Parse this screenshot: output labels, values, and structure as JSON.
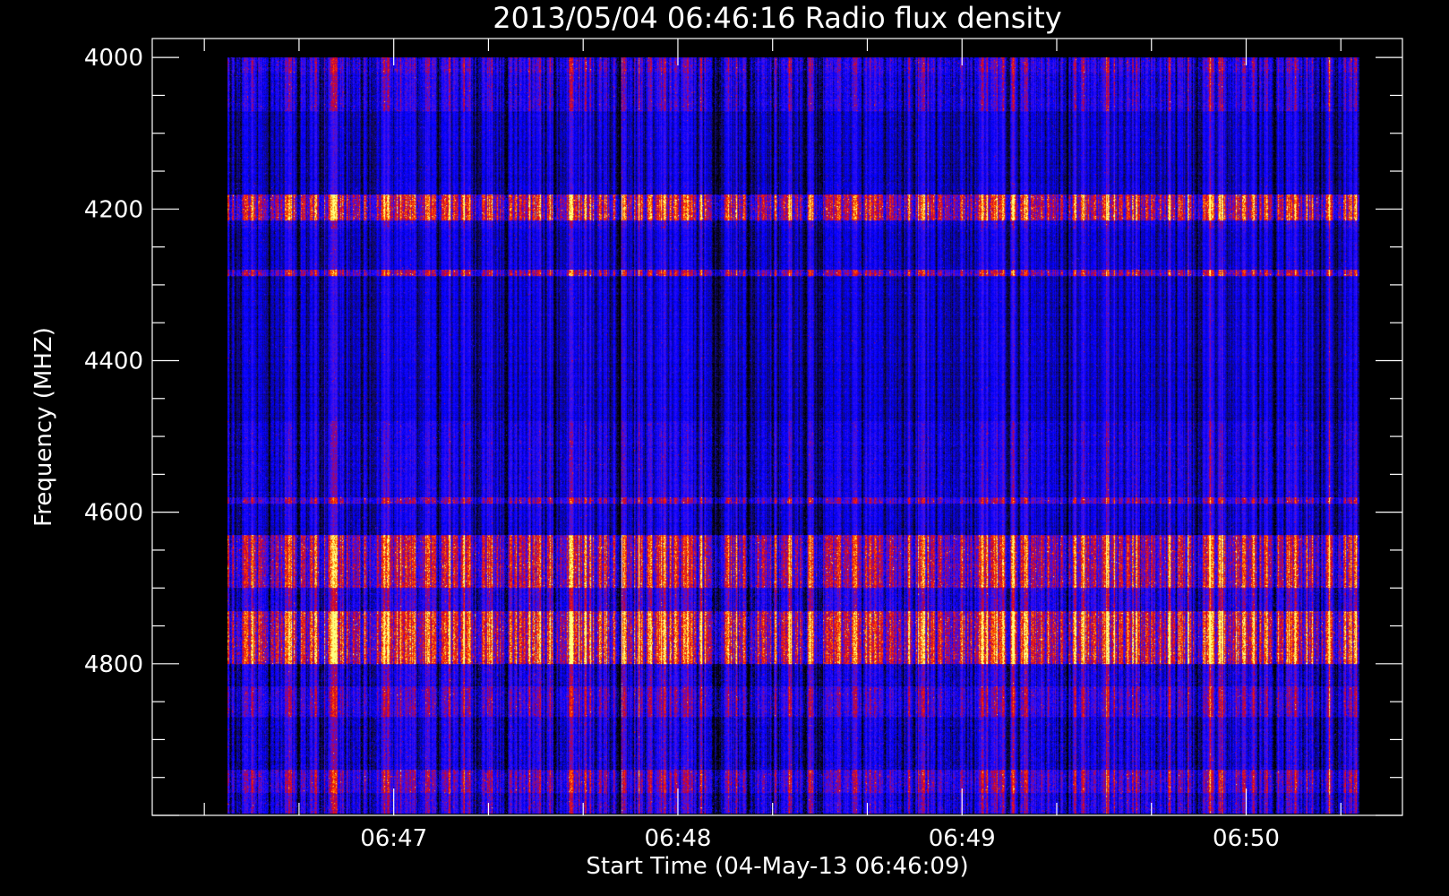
{
  "chart_data": {
    "type": "heatmap",
    "title": "2013/05/04 06:46:16 Radio flux density",
    "xlabel": "Start Time (04-May-13 06:46:09)",
    "ylabel": "Frequency (MHZ)",
    "x_axis": {
      "unit": "minutes after 06:46",
      "range": [
        0.15,
        4.55
      ],
      "major_ticks": [
        {
          "value": 1,
          "label": "06:47"
        },
        {
          "value": 2,
          "label": "06:48"
        },
        {
          "value": 3,
          "label": "06:49"
        },
        {
          "value": 4,
          "label": "06:50"
        }
      ],
      "minor_step": 0.333333
    },
    "y_axis": {
      "unit": "MHz",
      "range": [
        3975,
        5000
      ],
      "inverted": true,
      "major_ticks": [
        {
          "value": 4000,
          "label": "4000"
        },
        {
          "value": 4200,
          "label": "4200"
        },
        {
          "value": 4400,
          "label": "4400"
        },
        {
          "value": 4600,
          "label": "4600"
        },
        {
          "value": 4800,
          "label": "4800"
        }
      ],
      "minor_step": 50
    },
    "data_extent": {
      "x": [
        0.415,
        4.4
      ],
      "y": [
        4000,
        4998
      ]
    },
    "colors": {
      "background": "#000000",
      "axes": "#ffffff",
      "text": "#ffffff",
      "colormap": [
        "#000000",
        "#1a0a60",
        "#0000ff",
        "#5a00e0",
        "#c00030",
        "#ff2000",
        "#ff9000",
        "#ffff80"
      ]
    },
    "grid": false,
    "legend": "none",
    "bands": [
      {
        "from": 4000,
        "to": 4020,
        "level": 0.35,
        "detail": 0.6
      },
      {
        "from": 4020,
        "to": 4055,
        "level": 0.3,
        "detail": 0.5
      },
      {
        "from": 4055,
        "to": 4070,
        "level": 0.32,
        "detail": 0.5
      },
      {
        "from": 4070,
        "to": 4180,
        "level": 0.22,
        "detail": 0.25
      },
      {
        "from": 4180,
        "to": 4215,
        "level": 0.58,
        "detail": 0.9
      },
      {
        "from": 4215,
        "to": 4225,
        "level": 0.28,
        "detail": 0.4
      },
      {
        "from": 4225,
        "to": 4280,
        "level": 0.24,
        "detail": 0.25
      },
      {
        "from": 4280,
        "to": 4288,
        "level": 0.5,
        "detail": 0.7
      },
      {
        "from": 4288,
        "to": 4480,
        "level": 0.22,
        "detail": 0.2
      },
      {
        "from": 4480,
        "to": 4580,
        "level": 0.27,
        "detail": 0.35
      },
      {
        "from": 4580,
        "to": 4588,
        "level": 0.45,
        "detail": 0.6
      },
      {
        "from": 4588,
        "to": 4630,
        "level": 0.24,
        "detail": 0.3
      },
      {
        "from": 4630,
        "to": 4700,
        "level": 0.55,
        "detail": 0.85
      },
      {
        "from": 4700,
        "to": 4730,
        "level": 0.33,
        "detail": 0.55
      },
      {
        "from": 4730,
        "to": 4800,
        "level": 0.62,
        "detail": 0.95
      },
      {
        "from": 4800,
        "to": 4830,
        "level": 0.28,
        "detail": 0.5
      },
      {
        "from": 4830,
        "to": 4870,
        "level": 0.38,
        "detail": 0.6
      },
      {
        "from": 4870,
        "to": 4940,
        "level": 0.26,
        "detail": 0.45
      },
      {
        "from": 4940,
        "to": 4970,
        "level": 0.42,
        "detail": 0.65
      },
      {
        "from": 4970,
        "to": 4998,
        "level": 0.32,
        "detail": 0.55
      }
    ]
  }
}
